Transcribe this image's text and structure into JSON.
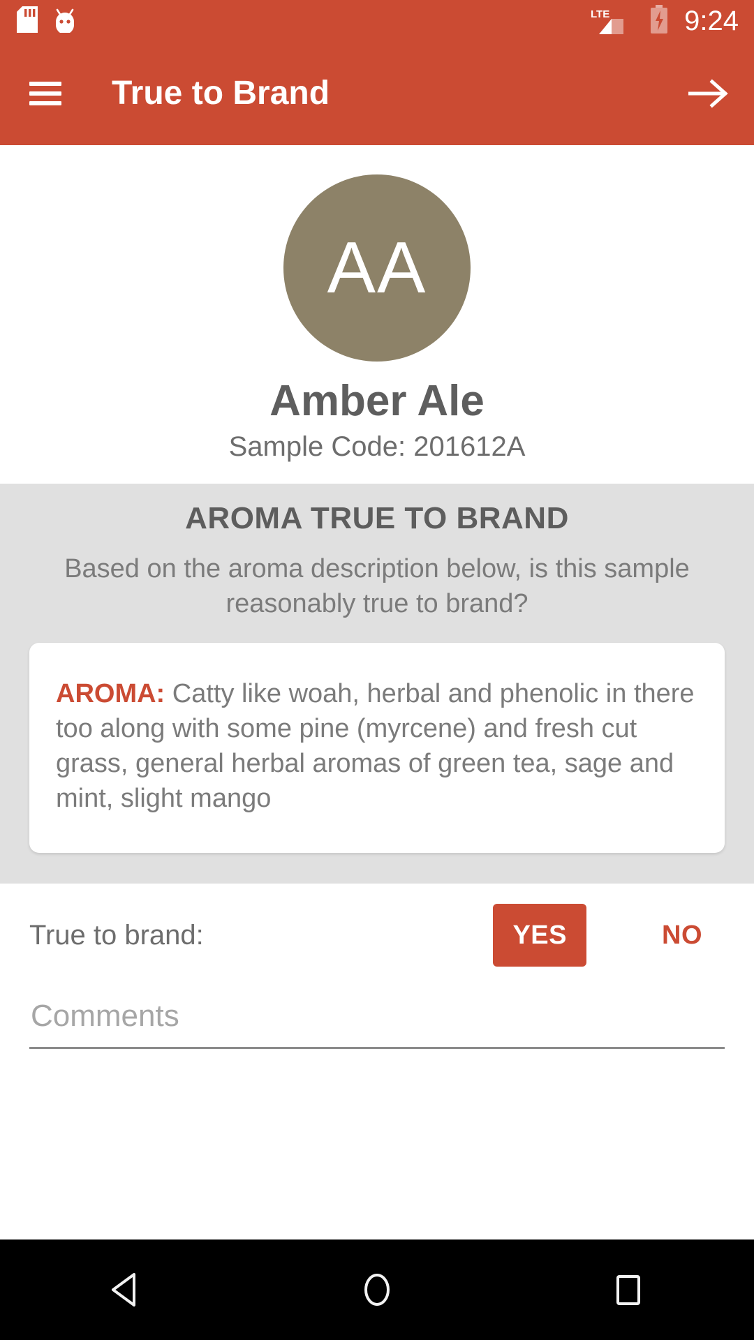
{
  "status_bar": {
    "icons": [
      "sd-card-icon",
      "android-head-icon"
    ],
    "network_label": "LTE",
    "signal_icon": "signal-bars-icon",
    "battery_icon": "battery-charging-icon",
    "time": "9:24"
  },
  "app_bar": {
    "menu_icon": "hamburger-menu-icon",
    "title": "True to Brand",
    "forward_icon": "arrow-right-icon"
  },
  "sample": {
    "avatar_initials": "AA",
    "avatar_color": "#8D8268",
    "name": "Amber Ale",
    "code_line": "Sample Code: 201612A"
  },
  "question": {
    "section_title": "AROMA TRUE TO BRAND",
    "prompt": "Based on the aroma description below, is this sample reasonably true to brand?",
    "card": {
      "label": "AROMA:",
      "description": " Catty like woah, herbal and phenolic in there too along with some pine (myrcene) and fresh cut grass, general herbal aromas of green tea, sage and mint, slight mango"
    }
  },
  "answer": {
    "label": "True to brand:",
    "yes_label": "YES",
    "no_label": "NO",
    "selected": "YES"
  },
  "comments": {
    "placeholder": "Comments",
    "value": ""
  },
  "nav_bar": {
    "back": "back-triangle-icon",
    "home": "home-circle-icon",
    "recents": "recents-square-icon"
  },
  "colors": {
    "primary": "#CB4B33",
    "section_bg": "#E0E0E0",
    "avatar": "#8D8268"
  }
}
